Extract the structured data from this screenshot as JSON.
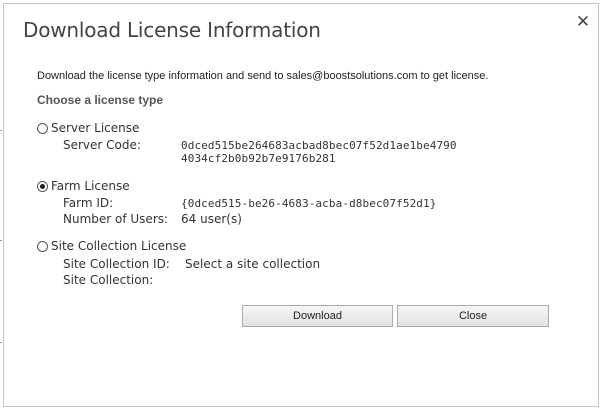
{
  "dialog": {
    "title": "Download License Information",
    "close_icon": "close-icon"
  },
  "instruction": "Download the license type information and send to sales@boostsolutions.com to get license.",
  "section_heading": "Choose a license type",
  "licenses": {
    "server": {
      "label": "Server License",
      "selected": false,
      "code_label": "Server Code:",
      "code_line1": "0dced515be264683acbad8bec07f52d1ae1be4790",
      "code_line2": "4034cf2b0b92b7e9176b281"
    },
    "farm": {
      "label": "Farm License",
      "selected": true,
      "id_label": "Farm ID:",
      "id_value": "{0dced515-be26-4683-acba-d8bec07f52d1}",
      "users_label": "Number of Users:",
      "users_value": "64 user(s)"
    },
    "site": {
      "label": "Site Collection License",
      "selected": false,
      "id_label": "Site Collection ID:",
      "id_value": "Select a site collection",
      "collection_label": "Site Collection:"
    }
  },
  "buttons": {
    "download": "Download",
    "close": "Close"
  }
}
